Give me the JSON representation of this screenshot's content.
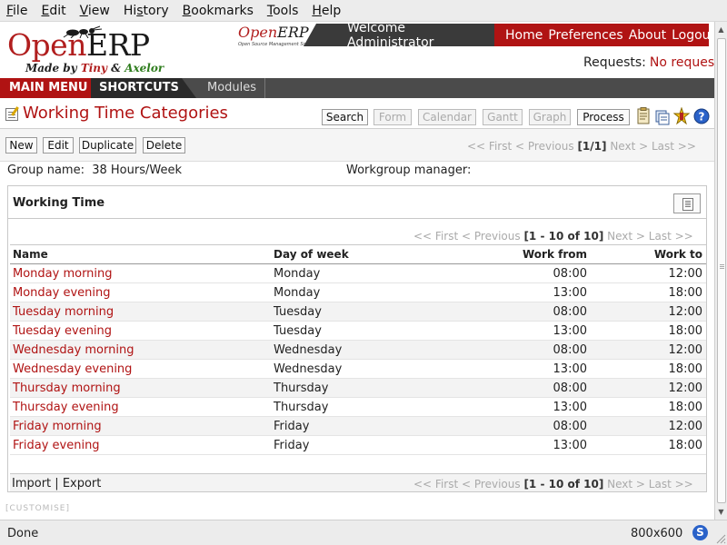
{
  "browser": {
    "menu": [
      "File",
      "Edit",
      "View",
      "History",
      "Bookmarks",
      "Tools",
      "Help"
    ],
    "menu_mnemonics": [
      "F",
      "E",
      "V",
      "s",
      "B",
      "T",
      "H"
    ],
    "status": "Done",
    "resolution": "800x600",
    "status_icon": "S"
  },
  "header": {
    "logo_open": "Open",
    "logo_erp": "ERP",
    "logo_tag_prefix": "Made by ",
    "logo_tag_tiny": "Tiny",
    "logo_tag_amp": " & ",
    "logo_tag_axelor": "Axelor",
    "small_logo_open": "Open",
    "small_logo_erp": "ERP",
    "small_logo_sub": "Open Source Management Solution",
    "welcome": "Welcome Administrator",
    "links": [
      "Home",
      "Preferences",
      "About",
      "Logout"
    ],
    "requests_label": "Requests:",
    "requests_value": "No request",
    "colors": {
      "brand_red": "#b01313",
      "dark": "#3a3a3a"
    }
  },
  "nav": {
    "main_menu": "MAIN MENU",
    "shortcuts": "SHORTCUTS",
    "modules": "Modules"
  },
  "page": {
    "title": "Working Time Categories",
    "view_buttons": [
      "Search",
      "Form",
      "Calendar",
      "Gantt",
      "Graph",
      "Process"
    ],
    "tool_icons": [
      "report-icon",
      "attachments-icon",
      "action-icon",
      "help-icon"
    ]
  },
  "toolbar": {
    "buttons": [
      "New",
      "Edit",
      "Duplicate",
      "Delete"
    ],
    "pager": {
      "first": "<< First",
      "previous": "< Previous",
      "range": "[1/1]",
      "next": "Next >",
      "last": "Last >>"
    }
  },
  "fields": {
    "group_label": "Group name:",
    "group_value": "38 Hours/Week",
    "manager_label": "Workgroup manager:",
    "manager_value": ""
  },
  "working_time": {
    "title": "Working Time",
    "pager": {
      "first": "<< First",
      "previous": "< Previous",
      "range": "[1 - 10 of 10]",
      "next": "Next >",
      "last": "Last >>"
    },
    "columns": [
      "Name",
      "Day of week",
      "Work from",
      "Work to"
    ],
    "rows": [
      {
        "name": "Monday morning",
        "day": "Monday",
        "from": "08:00",
        "to": "12:00"
      },
      {
        "name": "Monday evening",
        "day": "Monday",
        "from": "13:00",
        "to": "18:00"
      },
      {
        "name": "Tuesday morning",
        "day": "Tuesday",
        "from": "08:00",
        "to": "12:00"
      },
      {
        "name": "Tuesday evening",
        "day": "Tuesday",
        "from": "13:00",
        "to": "18:00"
      },
      {
        "name": "Wednesday morning",
        "day": "Wednesday",
        "from": "08:00",
        "to": "12:00"
      },
      {
        "name": "Wednesday evening",
        "day": "Wednesday",
        "from": "13:00",
        "to": "18:00"
      },
      {
        "name": "Thursday morning",
        "day": "Thursday",
        "from": "08:00",
        "to": "12:00"
      },
      {
        "name": "Thursday evening",
        "day": "Thursday",
        "from": "13:00",
        "to": "18:00"
      },
      {
        "name": "Friday morning",
        "day": "Friday",
        "from": "08:00",
        "to": "12:00"
      },
      {
        "name": "Friday evening",
        "day": "Friday",
        "from": "13:00",
        "to": "18:00"
      }
    ],
    "import": "Import",
    "separator": " | ",
    "export": "Export"
  },
  "customise": "[CUSTOMISE]"
}
